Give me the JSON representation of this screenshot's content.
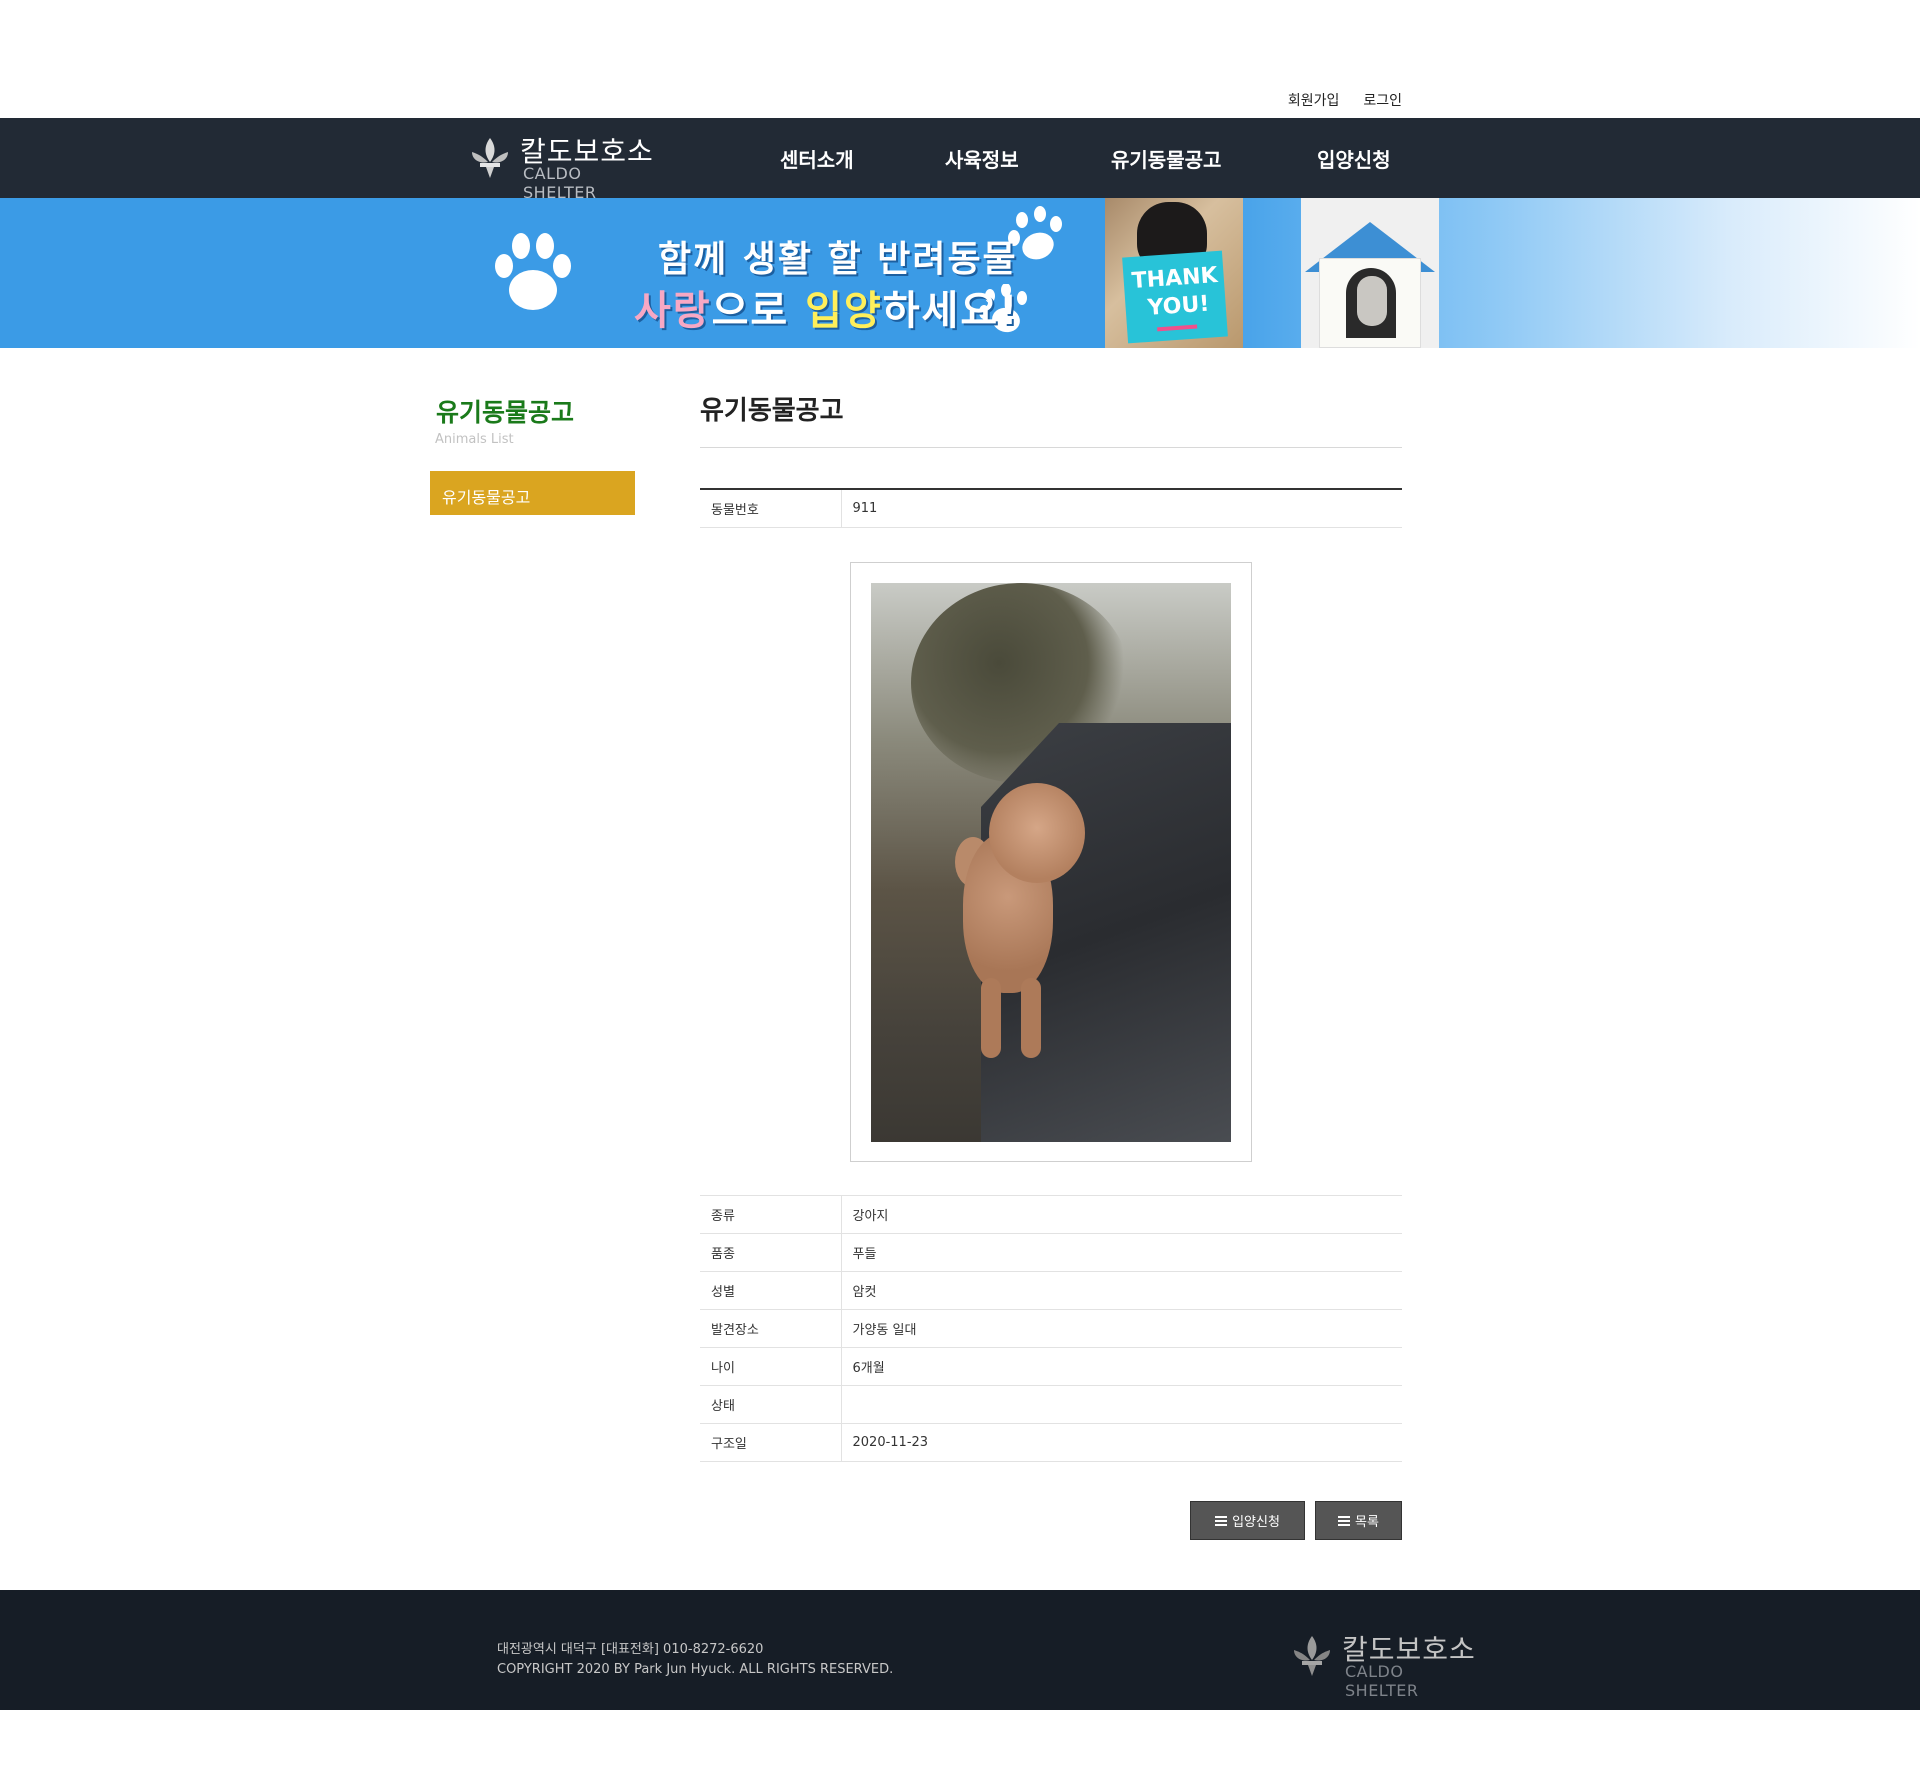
{
  "util_links": {
    "signup": "회원가입",
    "login": "로그인"
  },
  "brand": {
    "name_ko": "칼도보호소",
    "name_en": "CALDO SHELTER"
  },
  "nav": {
    "items": [
      {
        "label": "센터소개"
      },
      {
        "label": "사육정보"
      },
      {
        "label": "유기동물공고"
      },
      {
        "label": "입양신청"
      }
    ]
  },
  "banner": {
    "line1": "함께 생활 할 반려동물",
    "line2_parts": [
      "사랑",
      "으로 ",
      "입양",
      "하세요!"
    ],
    "photo1_text": [
      "THANK",
      "YOU!"
    ],
    "colors": {
      "base": "#3b9be6",
      "pink": "#f7a8c4",
      "yellow": "#ffef5a",
      "sign": "#28c3d8",
      "roof": "#3d8fd4"
    }
  },
  "sidebar": {
    "title": "유기동물공고",
    "subtitle": "Animals List",
    "items": [
      {
        "label": "유기동물공고",
        "active": true
      }
    ],
    "colors": {
      "title": "#1a7a1a",
      "active_bg": "#daa520"
    }
  },
  "content": {
    "title": "유기동물공고",
    "top_rows": [
      {
        "key": "동물번호",
        "value": "911"
      }
    ],
    "rows": [
      {
        "key": "종류",
        "value": "강아지"
      },
      {
        "key": "품종",
        "value": "푸들"
      },
      {
        "key": "성별",
        "value": "암컷"
      },
      {
        "key": "발견장소",
        "value": "가양동 일대"
      },
      {
        "key": "나이",
        "value": "6개월"
      },
      {
        "key": "상태",
        "value": ""
      },
      {
        "key": "구조일",
        "value": "2020-11-23"
      }
    ],
    "buttons": {
      "adopt": "입양신청",
      "list": "목록",
      "icon": "list-icon"
    }
  },
  "footer": {
    "address": "대전광역시 대덕구 [대표전화] 010-8272-6620",
    "copyright": "COPYRIGHT 2020 BY Park Jun Hyuck. ALL RIGHTS RESERVED.",
    "colors": {
      "bg": "#161d26",
      "header_bg": "#222a35"
    }
  }
}
